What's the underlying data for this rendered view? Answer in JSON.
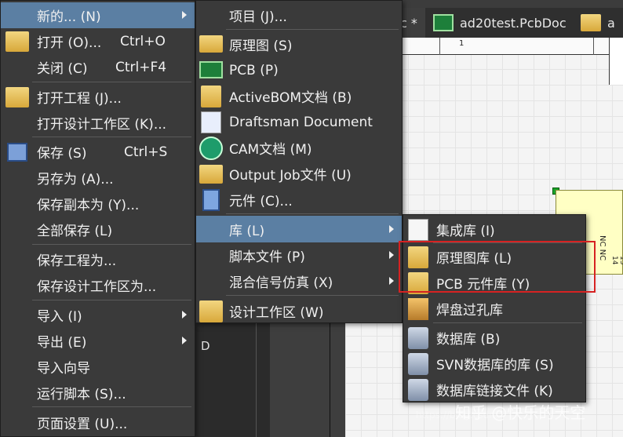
{
  "tabs": [
    {
      "label": "c *"
    },
    {
      "label": "ad20test.PcbDoc"
    },
    {
      "label": "a"
    }
  ],
  "canvas": {
    "ruler_number": "1",
    "bg_panel_letter": "D",
    "pin_labels": "NC NC",
    "pin_numbers": "13 14"
  },
  "file_menu": {
    "items": [
      {
        "label": "新的... (N)",
        "shortcut": "",
        "icon": "none",
        "submenu": true
      },
      {
        "label": "打开 (O)...",
        "shortcut": "Ctrl+O",
        "icon": "open-folder-icon",
        "submenu": false
      },
      {
        "label": "关闭 (C)",
        "shortcut": "Ctrl+F4",
        "icon": "none",
        "submenu": false
      },
      {
        "label": "打开工程 (J)...",
        "shortcut": "",
        "icon": "open-project-icon",
        "submenu": false
      },
      {
        "label": "打开设计工作区 (K)...",
        "shortcut": "",
        "icon": "none",
        "submenu": false
      },
      {
        "label": "保存 (S)",
        "shortcut": "Ctrl+S",
        "icon": "save-icon",
        "submenu": false
      },
      {
        "label": "另存为 (A)...",
        "shortcut": "",
        "icon": "none",
        "submenu": false
      },
      {
        "label": "保存副本为 (Y)...",
        "shortcut": "",
        "icon": "none",
        "submenu": false
      },
      {
        "label": "全部保存 (L)",
        "shortcut": "",
        "icon": "none",
        "submenu": false
      },
      {
        "label": "保存工程为...",
        "shortcut": "",
        "icon": "none",
        "submenu": false
      },
      {
        "label": "保存设计工作区为...",
        "shortcut": "",
        "icon": "none",
        "submenu": false
      },
      {
        "label": "导入 (I)",
        "shortcut": "",
        "icon": "none",
        "submenu": true
      },
      {
        "label": "导出 (E)",
        "shortcut": "",
        "icon": "none",
        "submenu": true
      },
      {
        "label": "导入向导",
        "shortcut": "",
        "icon": "none",
        "submenu": false
      },
      {
        "label": "运行脚本 (S)...",
        "shortcut": "",
        "icon": "none",
        "submenu": false
      },
      {
        "label": "页面设置 (U)...",
        "shortcut": "",
        "icon": "none",
        "submenu": false
      }
    ]
  },
  "new_menu": {
    "items": [
      {
        "label": "项目 (J)...",
        "icon": "none",
        "submenu": false
      },
      {
        "label": "原理图 (S)",
        "icon": "schematic-icon",
        "submenu": false
      },
      {
        "label": "PCB (P)",
        "icon": "pcb-icon",
        "submenu": false
      },
      {
        "label": "ActiveBOM文档 (B)",
        "icon": "bom-icon",
        "submenu": false
      },
      {
        "label": "Draftsman Document",
        "icon": "draftsman-icon",
        "submenu": false
      },
      {
        "label": "CAM文档 (M)",
        "icon": "cam-icon",
        "submenu": false
      },
      {
        "label": "Output Job文件 (U)",
        "icon": "output-job-icon",
        "submenu": false
      },
      {
        "label": "元件 (C)...",
        "icon": "component-icon",
        "submenu": false
      },
      {
        "label": "库 (L)",
        "icon": "none",
        "submenu": true
      },
      {
        "label": "脚本文件 (P)",
        "icon": "none",
        "submenu": true
      },
      {
        "label": "混合信号仿真 (X)",
        "icon": "none",
        "submenu": true
      },
      {
        "label": "设计工作区 (W)",
        "icon": "workspace-icon",
        "submenu": false
      }
    ]
  },
  "lib_menu": {
    "items": [
      {
        "label": "集成库 (I)",
        "icon": "integrated-lib-icon"
      },
      {
        "label": "原理图库 (L)",
        "icon": "schlib-icon"
      },
      {
        "label": "PCB 元件库 (Y)",
        "icon": "pcblib-icon"
      },
      {
        "label": "焊盘过孔库",
        "icon": "pad-via-lib-icon"
      },
      {
        "label": "数据库 (B)",
        "icon": "database-icon"
      },
      {
        "label": "SVN数据库的库 (S)",
        "icon": "svn-db-icon"
      },
      {
        "label": "数据库链接文件 (K)",
        "icon": "db-link-icon"
      }
    ]
  },
  "watermark": {
    "text": "知乎 @快乐的天空",
    "url": "https://blog.csdn"
  },
  "colors": {
    "highlight": "#5b7fa3",
    "redbox": "#d62222",
    "menu_bg": "#3a3a3a"
  }
}
